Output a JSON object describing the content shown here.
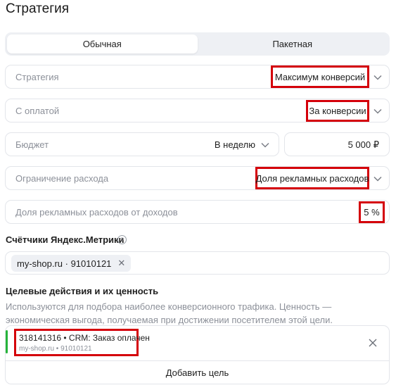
{
  "page": {
    "title": "Стратегия"
  },
  "tabs": [
    {
      "label": "Обычная",
      "active": true
    },
    {
      "label": "Пакетная",
      "active": false
    }
  ],
  "strategy": {
    "label": "Стратегия",
    "value": "Максимум конверсий"
  },
  "payment": {
    "label": "С оплатой",
    "value": "За конверсии"
  },
  "budget": {
    "label": "Бюджет",
    "period": "В неделю",
    "amount": "5 000 ₽"
  },
  "limit": {
    "label": "Ограничение расхода",
    "value": "Доля рекламных расходов"
  },
  "share": {
    "label": "Доля рекламных расходов от доходов",
    "value": "5 %"
  },
  "metrika": {
    "title": "Счётчики Яндекс.Метрики",
    "help_glyph": "?",
    "chip": "my-shop.ru · 91010121",
    "chip_close": "✕"
  },
  "goals": {
    "title": "Целевые действия и их ценность",
    "description": "Используются для подбора наиболее конверсионного трафика. Ценность — экономическая выгода, получаемая при достижении посетителем этой цели.",
    "items": [
      {
        "title": "318141316 • CRM: Заказ оплачен",
        "subtitle": "my-shop.ru • 91010121"
      }
    ],
    "add_label": "Добавить цель"
  },
  "colors": {
    "highlight": "#d4000a",
    "goal_accent": "#25b33a",
    "tab_bg": "#eef0f4"
  }
}
